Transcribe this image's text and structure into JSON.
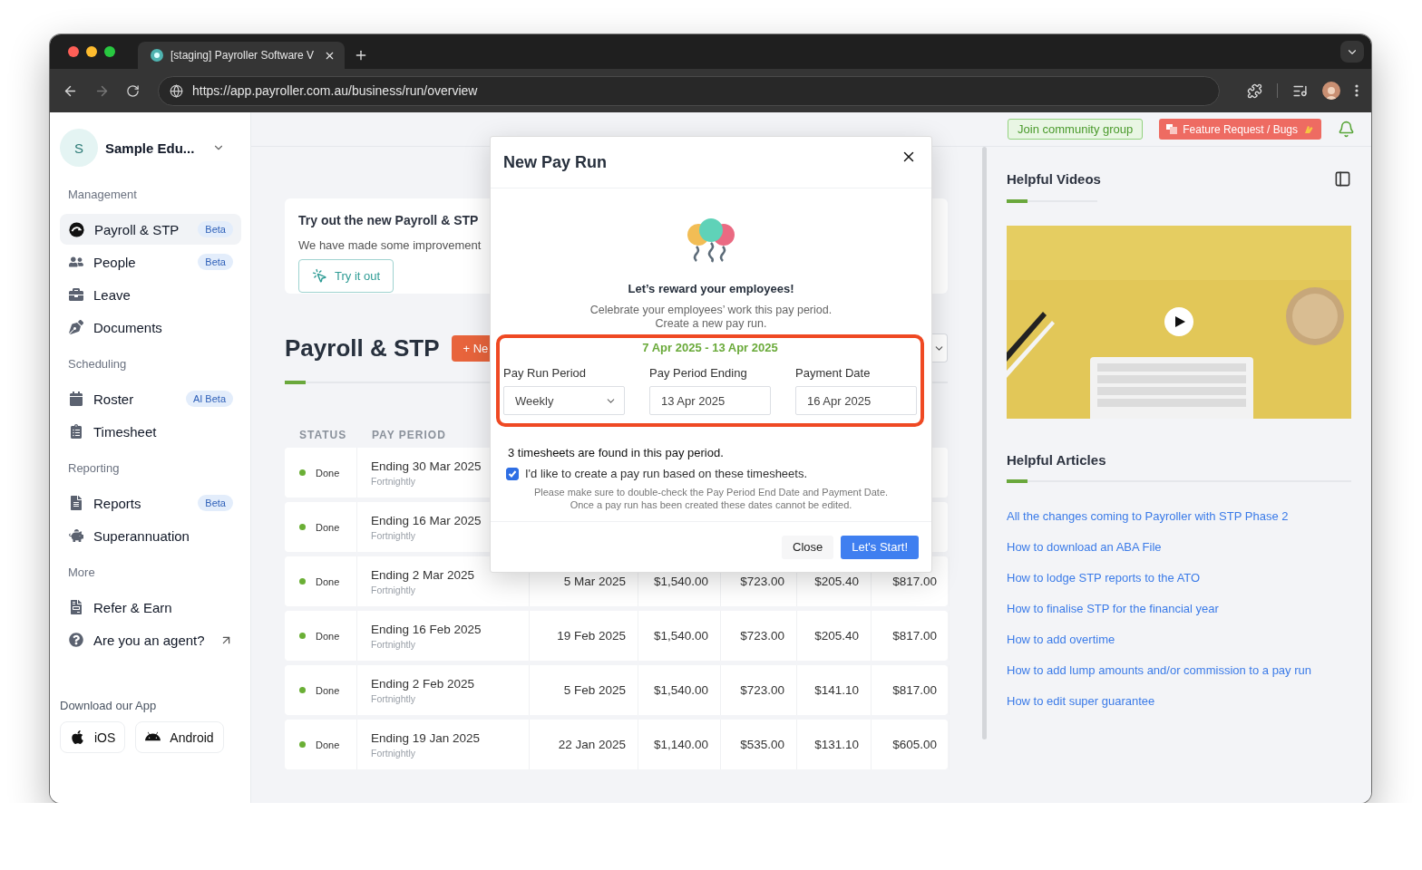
{
  "browser": {
    "tab_title": "[staging] Payroller Software V",
    "url": "https://app.payroller.com.au/business/run/overview",
    "forward_disabled": true
  },
  "sidebar": {
    "org": {
      "initial": "S",
      "name": "Sample Edu..."
    },
    "sections": [
      {
        "title": "Management",
        "items": [
          {
            "label": "Payroll & STP",
            "badge": "Beta",
            "selected": true,
            "external": false
          },
          {
            "label": "People",
            "badge": "Beta",
            "selected": false,
            "external": false
          },
          {
            "label": "Leave",
            "selected": false,
            "external": false
          },
          {
            "label": "Documents",
            "selected": false,
            "external": false
          }
        ]
      },
      {
        "title": "Scheduling",
        "items": [
          {
            "label": "Roster",
            "badge": "AI Beta",
            "selected": false,
            "external": false
          },
          {
            "label": "Timesheet",
            "selected": false,
            "external": false
          }
        ]
      },
      {
        "title": "Reporting",
        "items": [
          {
            "label": "Reports",
            "badge": "Beta",
            "selected": false,
            "external": false
          },
          {
            "label": "Superannuation",
            "selected": false,
            "external": false
          }
        ]
      },
      {
        "title": "More",
        "items": [
          {
            "label": "Refer & Earn",
            "selected": false,
            "external": false
          },
          {
            "label": "Are you an agent?",
            "selected": false,
            "external": true
          }
        ]
      }
    ],
    "download": {
      "title": "Download our App",
      "buttons": [
        "iOS",
        "Android"
      ]
    }
  },
  "header": {
    "community_button": "Join community group",
    "feedback_button": "Feature Request / Bugs"
  },
  "main": {
    "banner": {
      "title": "Try out the new Payroll & STP",
      "text": "We have made some improvement",
      "button": "Try it out"
    },
    "title": "Payroll & STP",
    "new_button": "+ Ne",
    "table": {
      "columns": [
        "STATUS",
        "PAY PERIOD"
      ],
      "rows": [
        {
          "status": "Done",
          "period": "Ending 30 Mar 2025",
          "frequency": "Fortnightly"
        },
        {
          "status": "Done",
          "period": "Ending 16 Mar 2025",
          "frequency": "Fortnightly"
        },
        {
          "status": "Done",
          "period": "Ending 2 Mar 2025",
          "frequency": "Fortnightly",
          "values": [
            "5 Mar 2025",
            "$1,540.00",
            "$723.00",
            "$205.40",
            "$817.00"
          ]
        },
        {
          "status": "Done",
          "period": "Ending 16 Feb 2025",
          "frequency": "Fortnightly",
          "values": [
            "19 Feb 2025",
            "$1,540.00",
            "$723.00",
            "$205.40",
            "$817.00"
          ]
        },
        {
          "status": "Done",
          "period": "Ending 2 Feb 2025",
          "frequency": "Fortnightly",
          "values": [
            "5 Feb 2025",
            "$1,540.00",
            "$723.00",
            "$141.10",
            "$817.00"
          ]
        },
        {
          "status": "Done",
          "period": "Ending 19 Jan 2025",
          "frequency": "Fortnightly",
          "values": [
            "22 Jan 2025",
            "$1,140.00",
            "$535.00",
            "$131.10",
            "$605.00"
          ]
        }
      ]
    }
  },
  "modal": {
    "title": "New Pay Run",
    "heading": "Let’s reward your employees!",
    "lines": [
      "Celebrate your employees’ work this pay period.",
      "Create a new pay run."
    ],
    "range": "7 Apr 2025 - 13 Apr 2025",
    "fields": [
      {
        "label": "Pay Run Period",
        "value": "Weekly",
        "kind": "select"
      },
      {
        "label": "Pay Period Ending",
        "value": "13 Apr 2025",
        "kind": "input"
      },
      {
        "label": "Payment Date",
        "value": "16 Apr 2025",
        "kind": "input"
      }
    ],
    "found": "3 timesheets are found in this pay period.",
    "confirm": {
      "label": "I'd like to create a pay run based on these timesheets.",
      "checked": true
    },
    "note": [
      "Please make sure to double-check the Pay Period End Date and Payment Date.",
      "Once a pay run has been created these dates cannot be edited."
    ],
    "close_button": "Close",
    "start_button": "Let's Start!"
  },
  "help": {
    "videos_title": "Helpful Videos",
    "articles_title": "Helpful Articles",
    "articles": [
      "All the changes coming to Payroller with STP Phase 2",
      "How to download an ABA File",
      "How to lodge STP reports to the ATO",
      "How to finalise STP for the financial year",
      "How to add overtime",
      "How to add lump amounts and/or commission to a pay run",
      "How to edit super guarantee"
    ]
  }
}
